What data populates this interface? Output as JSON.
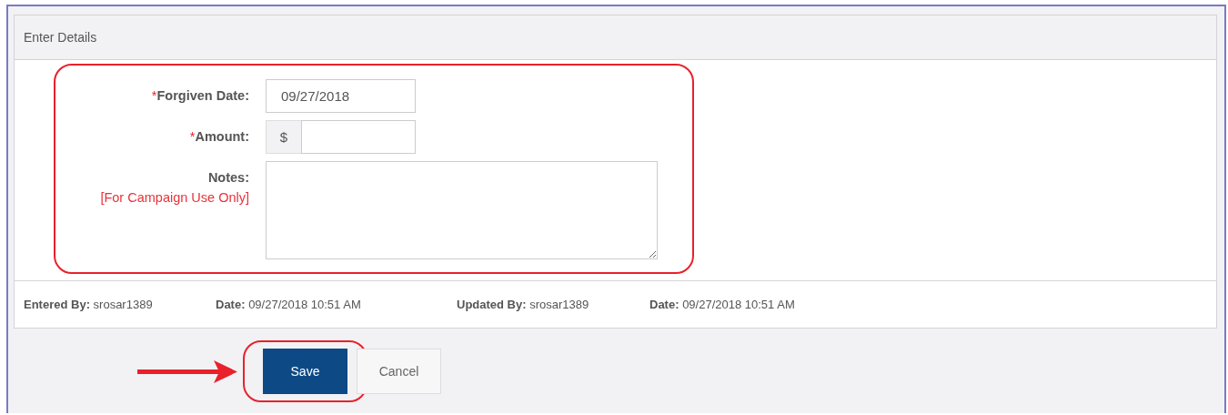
{
  "section": {
    "title": "Enter Details"
  },
  "fields": [
    {
      "kind": "text",
      "label": "Forgiven Date:",
      "required_mark": "*",
      "value": "09/27/2018"
    },
    {
      "kind": "currency",
      "label": "Amount:",
      "required_mark": "*",
      "prefix": "$"
    },
    {
      "kind": "textarea",
      "label": "Notes:",
      "note": "[For Campaign Use Only]"
    }
  ],
  "audit": [
    {
      "label": "Entered By:",
      "value": "srosar1389"
    },
    {
      "label": "Date:",
      "value": "09/27/2018 10:51 AM"
    },
    {
      "label": "Updated By:",
      "value": "srosar1389"
    },
    {
      "label": "Date:",
      "value": "09/27/2018 10:51 AM"
    }
  ],
  "buttons": [
    {
      "kind": "primary",
      "label": "Save",
      "highlighted": true
    },
    {
      "kind": "secondary",
      "label": "Cancel",
      "highlighted": false
    }
  ]
}
